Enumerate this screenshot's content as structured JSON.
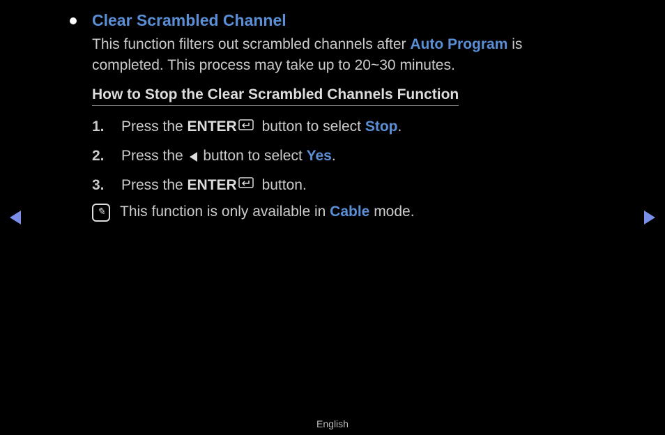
{
  "title": "Clear Scrambled Channel",
  "desc": {
    "part1": "This function filters out scrambled channels after ",
    "auto_program": "Auto Program",
    "part2": " is completed. This process may take up to 20~30 minutes."
  },
  "section_heading": "How to Stop the Clear Scrambled Channels Function",
  "steps": [
    {
      "num": "1.",
      "pre": "Press the ",
      "enter": "ENTER",
      "mid": " button to select ",
      "hl": "Stop",
      "end": "."
    },
    {
      "num": "2.",
      "pre": "Press the ",
      "mid": " button to select ",
      "hl": "Yes",
      "end": "."
    },
    {
      "num": "3.",
      "pre": "Press the ",
      "enter": "ENTER",
      "end": " button."
    }
  ],
  "note": {
    "pre": "This function is only available in ",
    "hl": "Cable",
    "end": " mode."
  },
  "footer": "English"
}
